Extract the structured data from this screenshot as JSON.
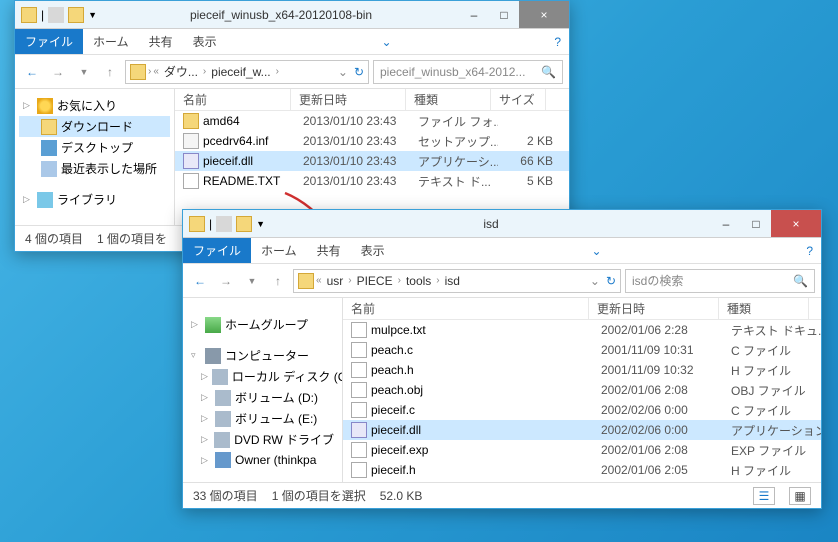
{
  "win1": {
    "title": "pieceif_winusb_x64-20120108-bin",
    "ribbon": {
      "file": "ファイル",
      "home": "ホーム",
      "share": "共有",
      "view": "表示"
    },
    "breadcrumb": [
      "ダウ...",
      "pieceif_w..."
    ],
    "search_placeholder": "pieceif_winusb_x64-2012...",
    "nav": {
      "fav": "お気に入り",
      "downloads": "ダウンロード",
      "desktop": "デスクトップ",
      "recent": "最近表示した場所",
      "libraries": "ライブラリ"
    },
    "cols": {
      "name": "名前",
      "date": "更新日時",
      "type": "種類",
      "size": "サイズ"
    },
    "files": [
      {
        "icon": "fold2",
        "name": "amd64",
        "date": "2013/01/10 23:43",
        "type": "ファイル フォ...",
        "size": ""
      },
      {
        "icon": "inf",
        "name": "pcedrv64.inf",
        "date": "2013/01/10 23:43",
        "type": "セットアップ...",
        "size": "2 KB"
      },
      {
        "icon": "dll",
        "name": "pieceif.dll",
        "date": "2013/01/10 23:43",
        "type": "アプリケーシ...",
        "size": "66 KB",
        "sel": true
      },
      {
        "icon": "txt",
        "name": "README.TXT",
        "date": "2013/01/10 23:43",
        "type": "テキスト ド...",
        "size": "5 KB"
      }
    ],
    "status": {
      "items": "4 個の項目",
      "sel": "1 個の項目を"
    }
  },
  "win2": {
    "title": "isd",
    "ribbon": {
      "file": "ファイル",
      "home": "ホーム",
      "share": "共有",
      "view": "表示"
    },
    "breadcrumb": [
      "usr",
      "PIECE",
      "tools",
      "isd"
    ],
    "search_placeholder": "isdの検索",
    "nav": {
      "homegroup": "ホームグループ",
      "computer": "コンピューター",
      "localC": "ローカル ディスク (C",
      "volD": "ボリューム (D:)",
      "volE": "ボリューム (E:)",
      "dvd": "DVD RW ドライブ",
      "owner": "Owner (thinkpa"
    },
    "cols": {
      "name": "名前",
      "date": "更新日時",
      "type": "種類"
    },
    "files": [
      {
        "icon": "txt",
        "name": "mulpce.txt",
        "date": "2002/01/06 2:28",
        "type": "テキスト ドキュ..."
      },
      {
        "icon": "txt",
        "name": "peach.c",
        "date": "2001/11/09 10:31",
        "type": "C ファイル"
      },
      {
        "icon": "txt",
        "name": "peach.h",
        "date": "2001/11/09 10:32",
        "type": "H ファイル"
      },
      {
        "icon": "txt",
        "name": "peach.obj",
        "date": "2002/01/06 2:08",
        "type": "OBJ ファイル"
      },
      {
        "icon": "txt",
        "name": "pieceif.c",
        "date": "2002/02/06 0:00",
        "type": "C ファイル"
      },
      {
        "icon": "dll",
        "name": "pieceif.dll",
        "date": "2002/02/06 0:00",
        "type": "アプリケーション",
        "sel": true
      },
      {
        "icon": "txt",
        "name": "pieceif.exp",
        "date": "2002/01/06 2:08",
        "type": "EXP ファイル"
      },
      {
        "icon": "txt",
        "name": "pieceif.h",
        "date": "2002/01/06 2:05",
        "type": "H ファイル"
      }
    ],
    "status": {
      "items": "33 個の項目",
      "sel": "1 個の項目を選択",
      "size": "52.0 KB"
    }
  }
}
